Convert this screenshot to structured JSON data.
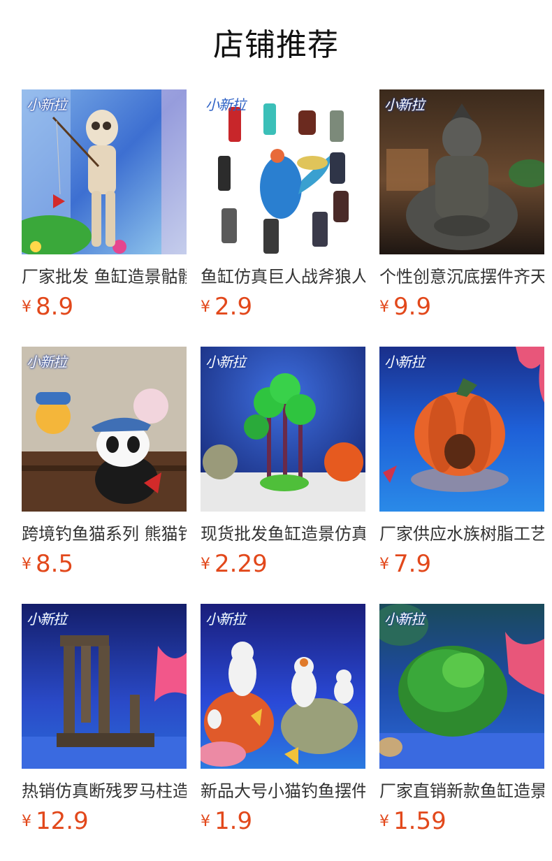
{
  "header": {
    "title": "店铺推荐"
  },
  "watermark_text": "小新拉",
  "currency_symbol": "¥",
  "accent_color": "#e2481b",
  "products": [
    {
      "name": "厂家批发 鱼缸造景骷髅钓鱼摆件",
      "price": "8.9",
      "image_icon": "skeleton-fishing-figure-image"
    },
    {
      "name": "鱼缸仿真巨人战斧狼人美人鱼",
      "price": "2.9",
      "image_icon": "warrior-figurines-image"
    },
    {
      "name": "个性创意沉底摆件齐天大圣",
      "price": "9.9",
      "image_icon": "monkey-king-statue-image"
    },
    {
      "name": "跨境钓鱼猫系列 熊猫钓鱼摆件",
      "price": "8.5",
      "image_icon": "panda-fishing-figure-image"
    },
    {
      "name": "现货批发鱼缸造景仿真椰子树",
      "price": "2.29",
      "image_icon": "palm-tree-ornament-image"
    },
    {
      "name": "厂家供应水族树脂工艺南瓜屋",
      "price": "7.9",
      "image_icon": "pumpkin-house-ornament-image"
    },
    {
      "name": "热销仿真断残罗马柱造景",
      "price": "12.9",
      "image_icon": "roman-ruins-ornament-image"
    },
    {
      "name": "新品大号小猫钓鱼摆件",
      "price": "1.9",
      "image_icon": "cats-fishing-figures-image"
    },
    {
      "name": "厂家直销新款鱼缸造景水草球",
      "price": "1.59",
      "image_icon": "green-plant-ball-image"
    }
  ]
}
